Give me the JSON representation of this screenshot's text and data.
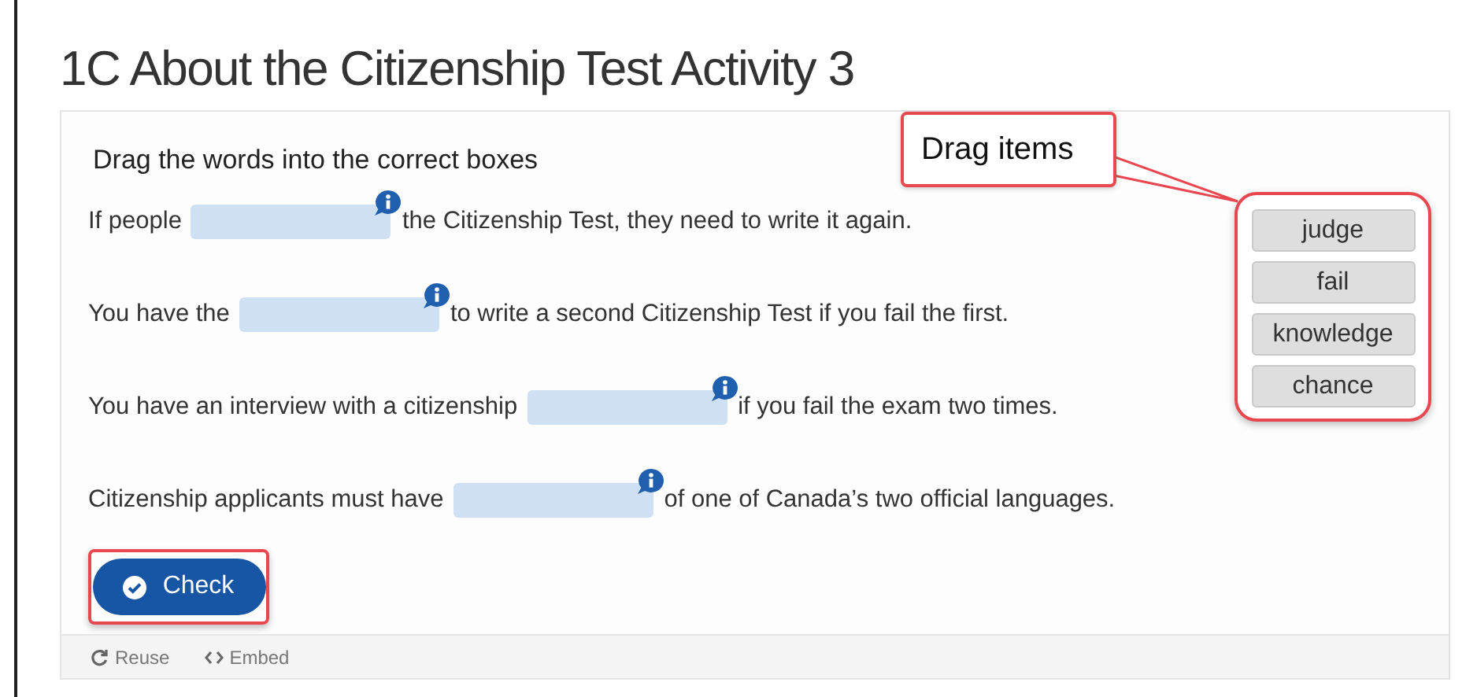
{
  "title": "1C About the Citizenship Test Activity 3",
  "instruction": "Drag the words into the correct boxes",
  "sentences": [
    {
      "before": "If people",
      "after": "the Citizenship Test, they need to write it again."
    },
    {
      "before": "You have the",
      "after": "to write a second Citizenship Test if you fail the first."
    },
    {
      "before": "You have an interview with a citizenship",
      "after": "if you fail the exam two times."
    },
    {
      "before": "Citizenship applicants must have",
      "after": "of one of Canada’s two official languages."
    }
  ],
  "drag_items": [
    "judge",
    "fail",
    "knowledge",
    "chance"
  ],
  "callout": "Drag items",
  "check_button": "Check",
  "footer": [
    {
      "kind": "reuse",
      "label": "Reuse"
    },
    {
      "kind": "embed",
      "label": "Embed"
    }
  ]
}
